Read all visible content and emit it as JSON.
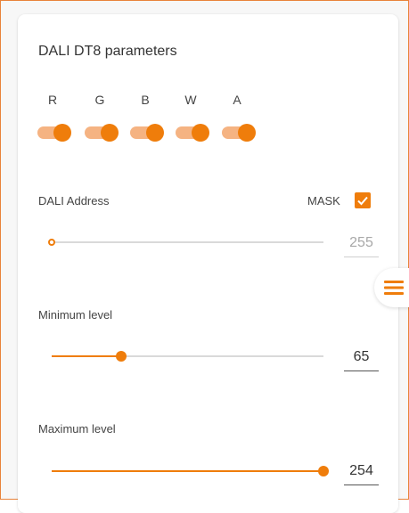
{
  "panel": {
    "title": "DALI DT8 parameters",
    "channels": [
      {
        "label": "R",
        "enabled": true
      },
      {
        "label": "G",
        "enabled": true
      },
      {
        "label": "B",
        "enabled": true
      },
      {
        "label": "W",
        "enabled": true
      },
      {
        "label": "A",
        "enabled": true
      }
    ],
    "dali_address": {
      "label": "DALI Address",
      "mask_label": "MASK",
      "mask_checked": true,
      "value": "255",
      "slider_fraction": 0
    },
    "minimum_level": {
      "label": "Minimum level",
      "value": "65",
      "slider_fraction": 0.255
    },
    "maximum_level": {
      "label": "Maximum level",
      "value": "254",
      "slider_fraction": 1.0
    }
  },
  "icons": {
    "menu": "hamburger-menu-icon",
    "checkbox": "checkmark-icon"
  },
  "colors": {
    "accent": "#ef7d0b",
    "accent_light": "#f5b382",
    "frame_border": "#e8833a"
  }
}
